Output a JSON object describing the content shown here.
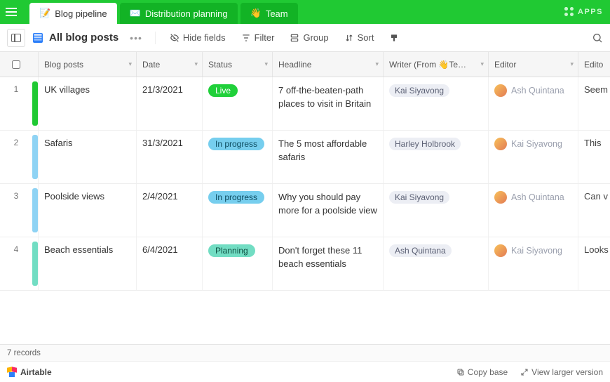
{
  "topbar": {
    "apps_label": "APPS",
    "tabs": [
      {
        "icon": "📝",
        "label": "Blog pipeline",
        "active": true
      },
      {
        "icon": "✉️",
        "label": "Distribution planning",
        "active": false
      },
      {
        "icon": "👋",
        "label": "Team",
        "active": false
      }
    ]
  },
  "toolbar": {
    "view_title": "All blog posts",
    "hide_fields": "Hide fields",
    "filter": "Filter",
    "group": "Group",
    "sort": "Sort"
  },
  "columns": {
    "blog_posts": "Blog posts",
    "date": "Date",
    "status": "Status",
    "headline": "Headline",
    "writer": "Writer (From 👋Te…",
    "editor": "Editor",
    "editor_notes_short": "Edito"
  },
  "rows": [
    {
      "num": "1",
      "bar": "live",
      "blog": "UK villages",
      "date": "21/3/2021",
      "status": "Live",
      "status_kind": "live",
      "headline": "7 off-the-beaten-path places to visit in Britain",
      "writer": "Kai Siyavong",
      "editor": "Ash Quintana",
      "notes": "Seem"
    },
    {
      "num": "2",
      "bar": "prog",
      "blog": "Safaris",
      "date": "31/3/2021",
      "status": "In progress",
      "status_kind": "prog",
      "headline": "The 5 most affordable safaris",
      "writer": "Harley Holbrook",
      "editor": "Kai Siyavong",
      "notes": "This"
    },
    {
      "num": "3",
      "bar": "prog",
      "blog": "Poolside views",
      "date": "2/4/2021",
      "status": "In progress",
      "status_kind": "prog",
      "headline": "Why you should pay more for a poolside view",
      "writer": "Kai Siyavong",
      "editor": "Ash Quintana",
      "notes": "Can v"
    },
    {
      "num": "4",
      "bar": "plan",
      "blog": "Beach essentials",
      "date": "6/4/2021",
      "status": "Planning",
      "status_kind": "plan",
      "headline": "Don't forget these 11 beach essentials",
      "writer": "Ash Quintana",
      "editor": "Kai Siyavong",
      "notes": "Looks"
    }
  ],
  "footer": {
    "record_count": "7 records",
    "brand": "Airtable",
    "copy_base": "Copy base",
    "view_larger": "View larger version"
  }
}
